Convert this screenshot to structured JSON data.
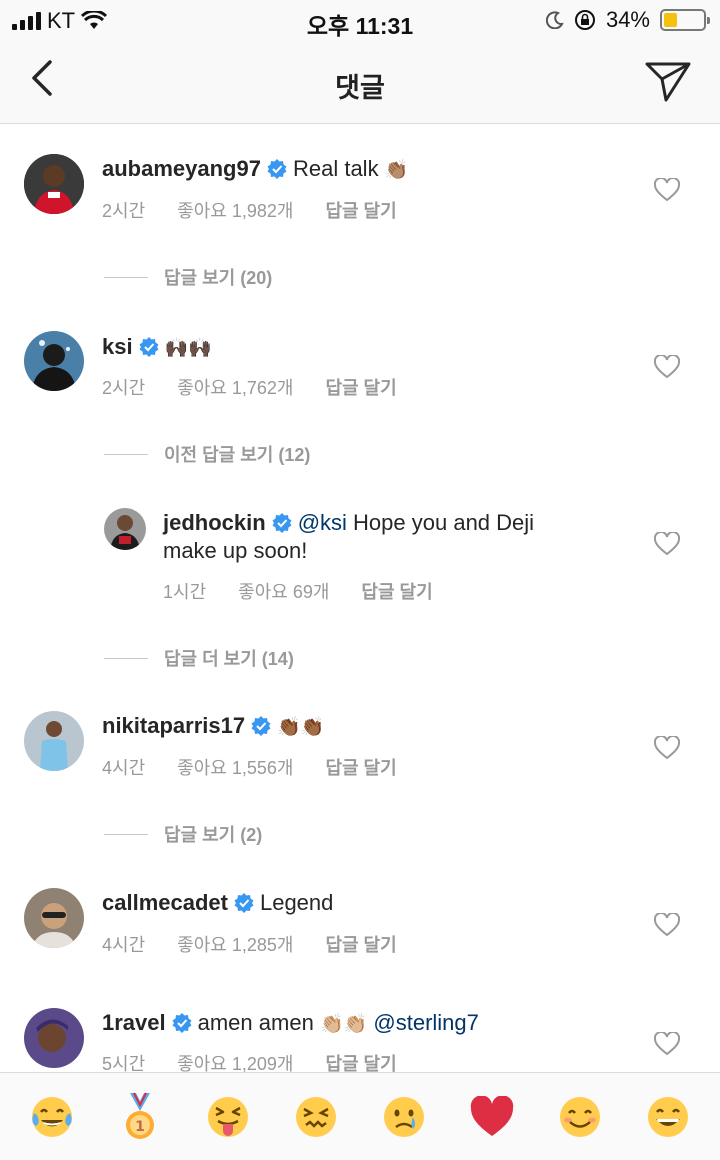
{
  "status_bar": {
    "carrier": "KT",
    "time": "오후 11:31",
    "battery_percent": "34%",
    "battery_level": 0.34,
    "icons": [
      "signal-bars-icon",
      "wifi-icon",
      "moon-icon",
      "orientation-lock-icon",
      "battery-icon"
    ]
  },
  "nav": {
    "title": "댓글",
    "back_icon": "back-chevron-icon",
    "send_icon": "send-direct-icon"
  },
  "comments": [
    {
      "username": "aubameyang97",
      "verified": true,
      "text": "Real talk",
      "emoji": "👏🏽",
      "time": "2시간",
      "likes": "좋아요 1,982개",
      "reply": "답글 달기",
      "view_replies": "답글 보기 (20)"
    },
    {
      "username": "ksi",
      "verified": true,
      "text": "",
      "emoji": "🙌🏿🙌🏿",
      "time": "2시간",
      "likes": "좋아요 1,762개",
      "reply": "답글 달기",
      "view_replies": "이전 답글 보기 (12)"
    },
    {
      "username": "jedhockin",
      "verified": true,
      "mention": "@ksi",
      "text_line1": "Hope you and Deji",
      "text_line2": "make up soon!",
      "time": "1시간",
      "likes": "좋아요 69개",
      "reply": "답글 달기",
      "view_replies": "답글 더 보기 (14)"
    },
    {
      "username": "nikitaparris17",
      "verified": true,
      "text": "",
      "emoji": "👏🏾👏🏾",
      "time": "4시간",
      "likes": "좋아요 1,556개",
      "reply": "답글 달기",
      "view_replies": "답글 보기 (2)"
    },
    {
      "username": "callmecadet",
      "verified": true,
      "text": "Legend",
      "time": "4시간",
      "likes": "좋아요 1,285개",
      "reply": "답글 달기"
    },
    {
      "username": "1ravel",
      "verified": true,
      "text": "amen amen",
      "emoji": "👏🏼👏🏼",
      "mention": "@sterling7",
      "time": "5시간",
      "likes": "좋아요 1,209개",
      "reply": "답글 달기"
    }
  ],
  "quick_emojis": [
    "😂",
    "🥇",
    "😝",
    "😖",
    "😢",
    "❤️",
    "😊",
    "😄"
  ],
  "colors": {
    "verified_blue": "#3897f0",
    "mention_blue": "#003569",
    "meta_gray": "#999999",
    "heart_red": "#ed4956"
  }
}
